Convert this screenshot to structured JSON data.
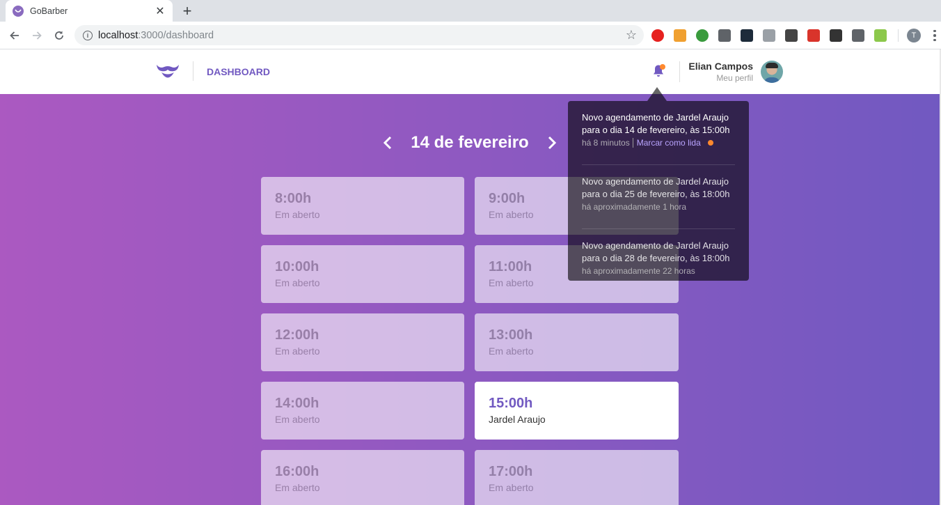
{
  "browser": {
    "tab_title": "GoBarber",
    "url_host": "localhost",
    "url_rest": ":3000/dashboard",
    "profile_initial": "T",
    "extensions": [
      {
        "name": "opera-icon",
        "color": "#e6211f"
      },
      {
        "name": "image-extension-icon",
        "color": "#f0a030"
      },
      {
        "name": "globe-extension-icon",
        "color": "#3a9b3d"
      },
      {
        "name": "screenshot-icon",
        "color": "#5f6368"
      },
      {
        "name": "adblock-icon",
        "color": "#1d2b3a"
      },
      {
        "name": "camera-icon",
        "color": "#9aa0a6"
      },
      {
        "name": "mask-icon",
        "color": "#444444"
      },
      {
        "name": "red-extension-icon",
        "color": "#d9342b"
      },
      {
        "name": "json-icon",
        "color": "#333333"
      },
      {
        "name": "car-icon",
        "color": "#5f6368"
      },
      {
        "name": "node-icon",
        "color": "#8cc84b"
      }
    ]
  },
  "header": {
    "nav_label": "DASHBOARD",
    "profile_name": "Elian Campos",
    "profile_link": "Meu perfil",
    "accent_color": "#7159c1"
  },
  "schedule": {
    "date_title": "14 de fevereiro",
    "slots": [
      {
        "time": "8:00h",
        "name": "Em aberto",
        "state": "past"
      },
      {
        "time": "9:00h",
        "name": "Em aberto",
        "state": "past"
      },
      {
        "time": "10:00h",
        "name": "Em aberto",
        "state": "past"
      },
      {
        "time": "11:00h",
        "name": "Em aberto",
        "state": "past"
      },
      {
        "time": "12:00h",
        "name": "Em aberto",
        "state": "past"
      },
      {
        "time": "13:00h",
        "name": "Em aberto",
        "state": "past"
      },
      {
        "time": "14:00h",
        "name": "Em aberto",
        "state": "past"
      },
      {
        "time": "15:00h",
        "name": "Jardel Araujo",
        "state": "booked"
      },
      {
        "time": "16:00h",
        "name": "Em aberto",
        "state": "past"
      },
      {
        "time": "17:00h",
        "name": "Em aberto",
        "state": "past"
      }
    ]
  },
  "notifications": [
    {
      "text": "Novo agendamento de Jardel Araujo para o dia 14 de fevereiro, às 15:00h",
      "time": "há 8 minutos",
      "mark_label": "Marcar como lida",
      "unread": true
    },
    {
      "text": "Novo agendamento de Jardel Araujo para o dia 25 de fevereiro, às 18:00h",
      "time": "há aproximadamente 1 hora",
      "unread": false
    },
    {
      "text": "Novo agendamento de Jardel Araujo para o dia 28 de fevereiro, às 18:00h",
      "time": "há aproximadamente 22 horas",
      "unread": false
    }
  ]
}
